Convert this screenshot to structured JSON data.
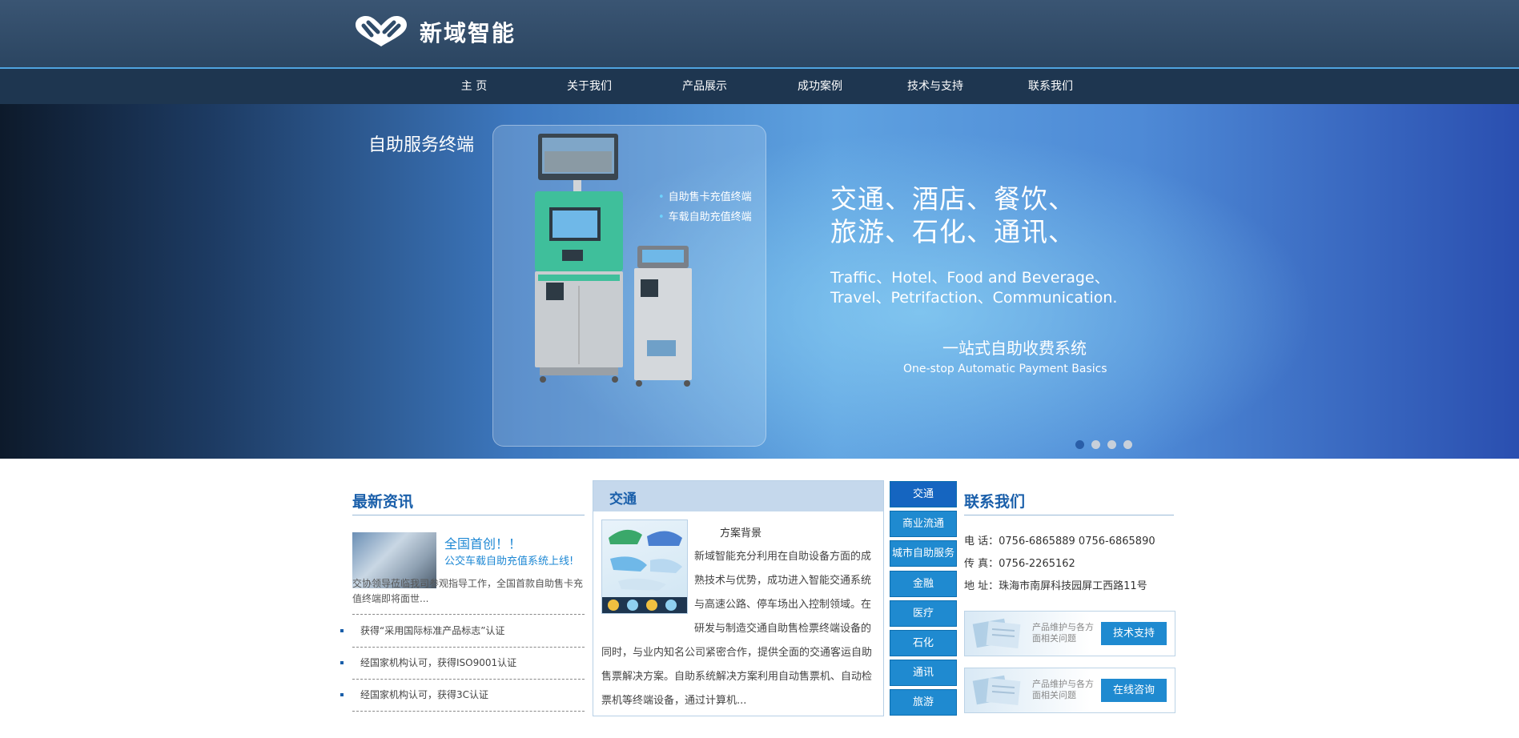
{
  "header": {
    "logo_text": "新域智能"
  },
  "nav": {
    "items": [
      "主 页",
      "关于我们",
      "产品展示",
      "成功案例",
      "技术与支持",
      "联系我们"
    ]
  },
  "banner": {
    "title": "自助服务终端",
    "bullets": [
      "自助售卡充值终端",
      "车载自助充值终端"
    ],
    "headline_cn_1": "交通、酒店、餐饮、",
    "headline_cn_2": "旅游、石化、通讯、",
    "headline_en_1": "Traffic、Hotel、Food and Beverage、",
    "headline_en_2": "Travel、Petrifaction、Communication.",
    "slogan_cn": "一站式自助收费系统",
    "slogan_en": "One-stop Automatic Payment Basics",
    "slide_count": 4,
    "active_slide": 1
  },
  "news": {
    "title": "最新资讯",
    "feature_head1": "全国首创！！",
    "feature_head2": "公交车载自助充值系统上线!",
    "feature_desc": "交协领导莅临我司参观指导工作，全国首款自助售卡充值终端即将面世...",
    "items": [
      "获得“采用国际标准产品标志”认证",
      "经国家机构认可，获得ISO9001认证",
      "经国家机构认可，获得3C认证"
    ]
  },
  "case": {
    "title": "交通",
    "subtitle": "方案背景",
    "text": "新域智能充分利用在自助设备方面的成熟技术与优势，成功进入智能交通系统与高速公路、停车场出入控制领域。在研发与制造交通自助售检票终端设备的同时，与业内知名公司紧密合作，提供全面的交通客运自助售票解决方案。自助系统解决方案利用自动售票机、自动检票机等终端设备，通过计算机..."
  },
  "categories": [
    "交通",
    "商业流通",
    "城市自助服务",
    "金融",
    "医疗",
    "石化",
    "通讯",
    "旅游"
  ],
  "contact": {
    "title": "联系我们",
    "phone": "电  话：0756-6865889 0756-6865890",
    "fax": "传  真：0756-2265162",
    "address": "地  址：珠海市南屏科技园屏工西路11号",
    "support_text": "产品维护与各方面相关问题",
    "tech_button": "技术支持",
    "online_button": "在线咨询"
  },
  "colors": {
    "accent": "#1f8ad0",
    "header_bg": "#2b4561",
    "nav_bg": "#1e3650",
    "title_blue": "#1a5faa"
  }
}
